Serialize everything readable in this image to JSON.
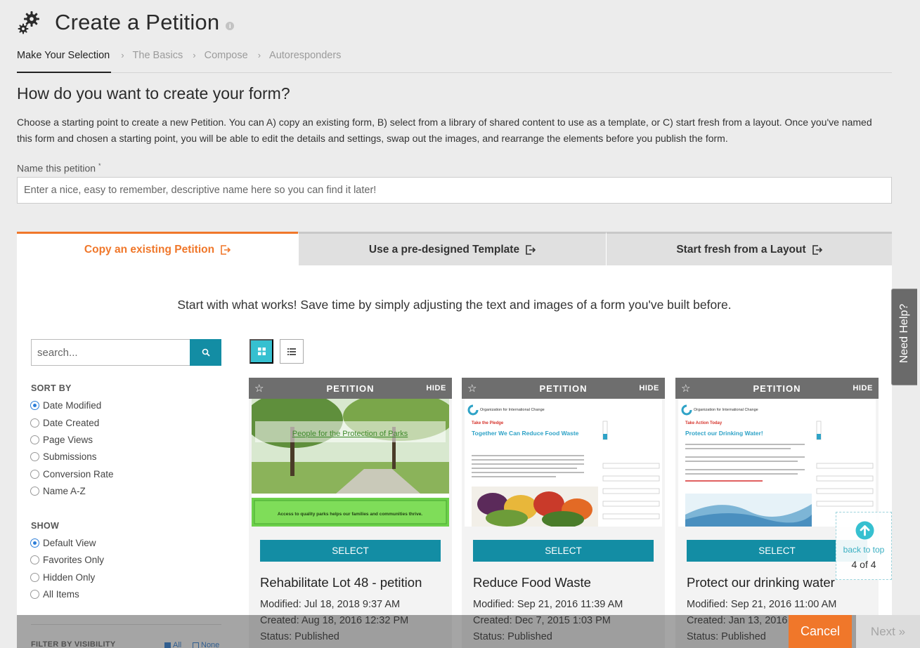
{
  "header": {
    "title": "Create a Petition",
    "info": "i"
  },
  "breadcrumb": [
    {
      "label": "Make Your Selection",
      "active": true
    },
    {
      "label": "The Basics",
      "active": false
    },
    {
      "label": "Compose",
      "active": false
    },
    {
      "label": "Autoresponders",
      "active": false
    }
  ],
  "breadcrumb_sep": "›",
  "intro": {
    "question": "How do you want to create your form?",
    "description": "Choose a starting point to create a new Petition. You can A) copy an existing form, B) select from a library of shared content to use as a template, or C) start fresh from a layout. Once you've named this form and chosen a starting point, you will be able to edit the details and settings, swap out the images, and rearrange the elements before you publish the form."
  },
  "name_field": {
    "label": "Name this petition",
    "required_mark": "*",
    "value": "",
    "placeholder": "Enter a nice, easy to remember, descriptive name here so you can find it later!"
  },
  "tabs": [
    {
      "label": "Copy an existing Petition",
      "active": true
    },
    {
      "label": "Use a pre-designed Template",
      "active": false
    },
    {
      "label": "Start fresh from a Layout",
      "active": false
    }
  ],
  "tagline": "Start with what works! Save time by simply adjusting the text and images of a form you've built before.",
  "search": {
    "placeholder": "search...",
    "value": ""
  },
  "sort_by": {
    "heading": "SORT BY",
    "options": [
      "Date Modified",
      "Date Created",
      "Page Views",
      "Submissions",
      "Conversion Rate",
      "Name A-Z"
    ],
    "selected": "Date Modified"
  },
  "show": {
    "heading": "SHOW",
    "options": [
      "Default View",
      "Favorites Only",
      "Hidden Only",
      "All Items"
    ],
    "selected": "Default View"
  },
  "filter_visibility": {
    "heading": "FILTER BY VISIBILITY",
    "all_label": "All",
    "none_label": "None"
  },
  "cards": [
    {
      "type_label": "PETITION",
      "hide_label": "HIDE",
      "select_label": "SELECT",
      "title": "Rehabilitate Lot 48 - petition",
      "modified": "Modified: Jul 18, 2018 9:37 AM",
      "created": "Created: Aug 18, 2016 12:32 PM",
      "status": "Status: Published",
      "thumb": {
        "heading": "People for the Protection of Parks",
        "caption": "Access to quality parks helps our families and communities thrive."
      }
    },
    {
      "type_label": "PETITION",
      "hide_label": "HIDE",
      "select_label": "SELECT",
      "title": "Reduce Food Waste",
      "modified": "Modified: Sep 21, 2016 11:39 AM",
      "created": "Created: Dec 7, 2015 1:03 PM",
      "status": "Status: Published",
      "thumb": {
        "org": "Organization for International Change",
        "kicker": "Take the Pledge",
        "headline": "Together We Can Reduce Food Waste"
      }
    },
    {
      "type_label": "PETITION",
      "hide_label": "HIDE",
      "select_label": "SELECT",
      "title": "Protect our drinking water",
      "modified": "Modified: Sep 21, 2016 11:00 AM",
      "created": "Created: Jan 13, 2016",
      "status": "Status: Published",
      "thumb": {
        "org": "Organization for International Change",
        "kicker": "Take Action Today",
        "headline": "Protect our Drinking Water!"
      }
    }
  ],
  "need_help": "Need Help?",
  "back_to_top": {
    "label": "back to top",
    "count": "4 of 4"
  },
  "footer": {
    "cancel": "Cancel",
    "next": "Next »"
  },
  "colors": {
    "accent": "#f0772a",
    "teal": "#138da4",
    "cyan": "#36c0d0"
  }
}
